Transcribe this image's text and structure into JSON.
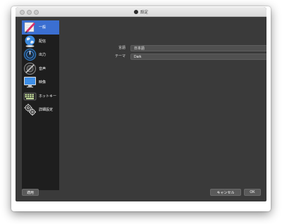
{
  "window": {
    "title": "設定"
  },
  "sidebar": {
    "items": [
      {
        "label": "一般",
        "icon": "pen-paper-icon",
        "active": true
      },
      {
        "label": "配信",
        "icon": "globe-icon",
        "active": false
      },
      {
        "label": "出力",
        "icon": "output-gauge-icon",
        "active": false
      },
      {
        "label": "音声",
        "icon": "audio-speaker-icon",
        "active": false
      },
      {
        "label": "映像",
        "icon": "monitor-icon",
        "active": false
      },
      {
        "label": "ホットキー",
        "icon": "keyboard-icon",
        "active": false
      },
      {
        "label": "詳細設定",
        "icon": "gears-icon",
        "active": false
      }
    ]
  },
  "general": {
    "language": {
      "label": "言語",
      "value": "日本語"
    },
    "theme": {
      "label": "テーマ",
      "value": "Dark"
    }
  },
  "buttons": {
    "apply": "適用",
    "cancel": "キャンセル",
    "ok": "OK"
  },
  "colors": {
    "accent": "#3b6fd1",
    "window_bg": "#3a3a3a",
    "sidebar_bg": "#1e1e1e"
  }
}
